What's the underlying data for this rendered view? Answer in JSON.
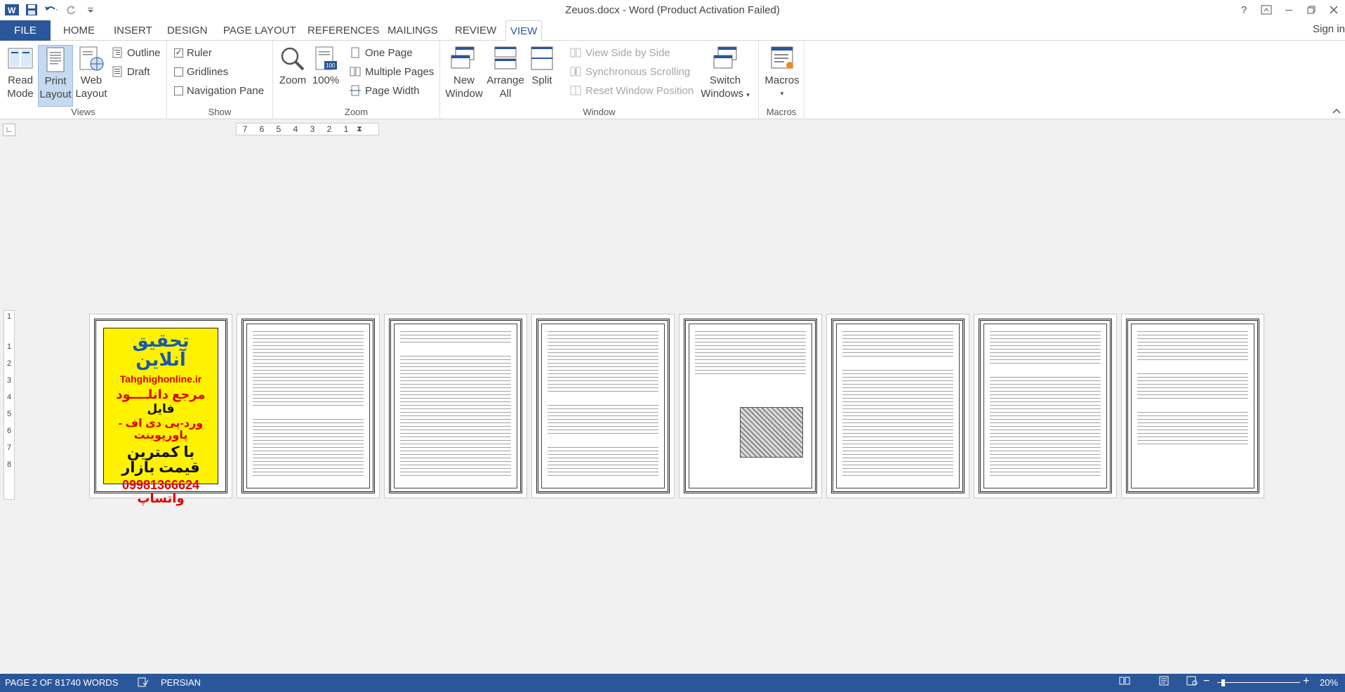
{
  "window": {
    "title": "Zeuos.docx - Word (Product Activation Failed)",
    "signin": "Sign in"
  },
  "tabs": [
    "FILE",
    "HOME",
    "INSERT",
    "DESIGN",
    "PAGE LAYOUT",
    "REFERENCES",
    "MAILINGS",
    "REVIEW",
    "VIEW"
  ],
  "active_tab": "VIEW",
  "ribbon": {
    "views": {
      "label": "Views",
      "read_mode": [
        "Read",
        "Mode"
      ],
      "print_layout": [
        "Print",
        "Layout"
      ],
      "web_layout": [
        "Web",
        "Layout"
      ],
      "outline": "Outline",
      "draft": "Draft"
    },
    "show": {
      "label": "Show",
      "ruler": "Ruler",
      "ruler_checked": true,
      "gridlines": "Gridlines",
      "navigation_pane": "Navigation Pane"
    },
    "zoom": {
      "label": "Zoom",
      "zoom": "Zoom",
      "hundred": "100%",
      "one_page": "One Page",
      "multiple_pages": "Multiple Pages",
      "page_width": "Page Width"
    },
    "window": {
      "label": "Window",
      "new_window": [
        "New",
        "Window"
      ],
      "arrange_all": [
        "Arrange",
        "All"
      ],
      "split": "Split",
      "view_side_by_side": "View Side by Side",
      "sync_scrolling": "Synchronous Scrolling",
      "reset_window": "Reset Window Position",
      "switch_windows": [
        "Switch",
        "Windows"
      ]
    },
    "macros": {
      "label": "Macros",
      "macros": "Macros"
    }
  },
  "ruler_numbers": [
    "7",
    "6",
    "5",
    "4",
    "3",
    "2",
    "1"
  ],
  "vruler_numbers": [
    "1",
    "1",
    "2",
    "3",
    "4",
    "5",
    "6",
    "7",
    "8"
  ],
  "ad": {
    "line1": "تحقیق آنلاین",
    "line2": "Tahghighonline.ir",
    "line3": "مرجع دانلــــود",
    "line4": "فایل",
    "line5": "ورد-پی دی اف - پاورپوینت",
    "line6": "با کمترین قیمت بازار",
    "line7": "09981366624 واتساپ"
  },
  "status": {
    "page": "PAGE 2 OF 8",
    "words": "1740 WORDS",
    "language": "PERSIAN",
    "zoom": "20%",
    "zoom_level_percent": 20
  }
}
